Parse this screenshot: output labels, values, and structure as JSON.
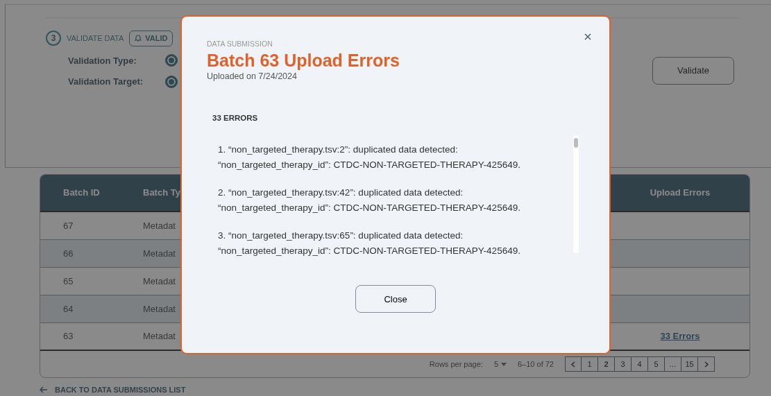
{
  "step": {
    "number": "3",
    "title": "VALIDATE DATA",
    "chip": "VALID"
  },
  "validation_fields": [
    {
      "label": "Validation Type:",
      "selected": true
    },
    {
      "label": "Validation Target:",
      "selected": true
    }
  ],
  "validate_button": "Validate",
  "table": {
    "columns": [
      "Batch ID",
      "Batch Ty",
      "Upload Errors"
    ],
    "rows": [
      {
        "batch_id": "67",
        "batch_type": "Metadat"
      },
      {
        "batch_id": "66",
        "batch_type": "Metadat"
      },
      {
        "batch_id": "65",
        "batch_type": "Metadat"
      },
      {
        "batch_id": "64",
        "batch_type": "Metadat"
      },
      {
        "batch_id": "63",
        "batch_type": "Metadat",
        "upload_errors": "33 Errors"
      }
    ]
  },
  "pagination": {
    "rows_per_page_label": "Rows per page:",
    "rows_per_page": "5",
    "range": "6–10 of 72",
    "pages": [
      {
        "label": "1",
        "selected": false
      },
      {
        "label": "2",
        "selected": true
      },
      {
        "label": "3",
        "selected": false
      },
      {
        "label": "4",
        "selected": false
      },
      {
        "label": "5",
        "selected": false
      },
      {
        "label": "…",
        "selected": false
      },
      {
        "label": "15",
        "selected": false
      }
    ]
  },
  "back_link": "BACK TO DATA SUBMISSIONS LIST",
  "modal": {
    "eyebrow": "DATA SUBMISSION",
    "title": "Batch 63 Upload Errors",
    "subtitle": "Uploaded on 7/24/2024",
    "count": "33 ERRORS",
    "errors": [
      "1. “non_targeted_therapy.tsv:2”: duplicated data detected: “non_targeted_therapy_id”: CTDC-NON-TARGETED-THERAPY-425649.",
      "2. “non_targeted_therapy.tsv:42”: duplicated data detected: “non_targeted_therapy_id”: CTDC-NON-TARGETED-THERAPY-425649.",
      "3. “non_targeted_therapy.tsv:65”: duplicated data detected: “non_targeted_therapy_id”: CTDC-NON-TARGETED-THERAPY-425649."
    ],
    "close_button": "Close"
  }
}
